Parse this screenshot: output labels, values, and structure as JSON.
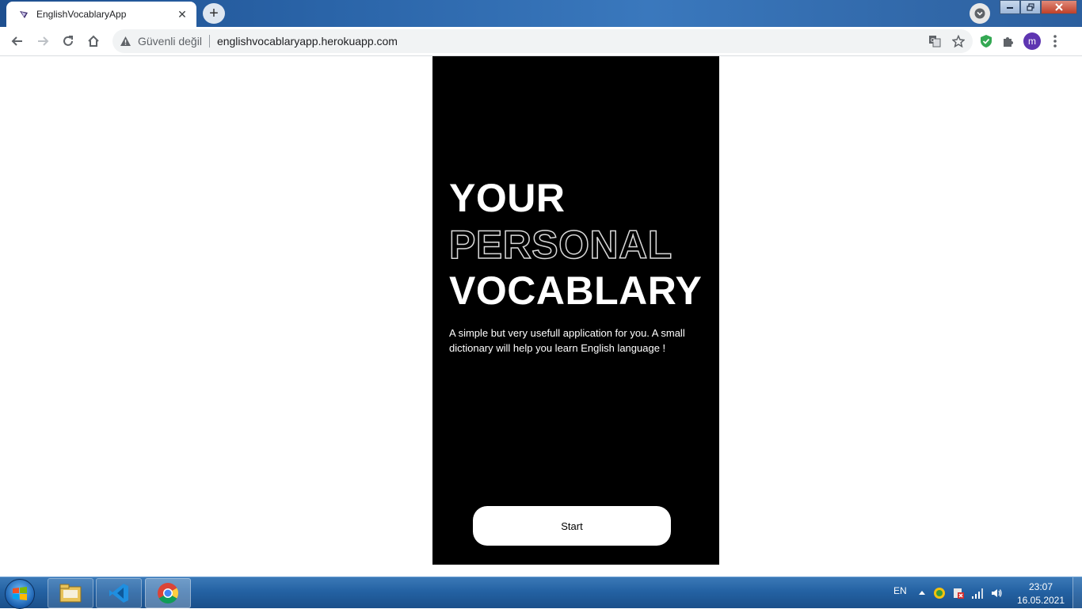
{
  "browser": {
    "tab_title": "EnglishVocablaryApp",
    "tab_close": "✕",
    "new_tab": "+",
    "security_label": "Güvenli değil",
    "url": "englishvocablaryapp.herokuapp.com",
    "profile_initial": "m"
  },
  "app": {
    "hero_line_1": "YOUR",
    "hero_line_2": "PERSONAL",
    "hero_line_3": "VOCABLARY",
    "description": "A simple but very usefull application for you. A small dictionary will help you learn English language !",
    "start_label": "Start",
    "colors": {
      "card_bg": "#000000",
      "text": "#ffffff",
      "outline": "#d9d9d9"
    }
  },
  "taskbar": {
    "language": "EN",
    "time": "23:07",
    "date": "16.05.2021"
  }
}
